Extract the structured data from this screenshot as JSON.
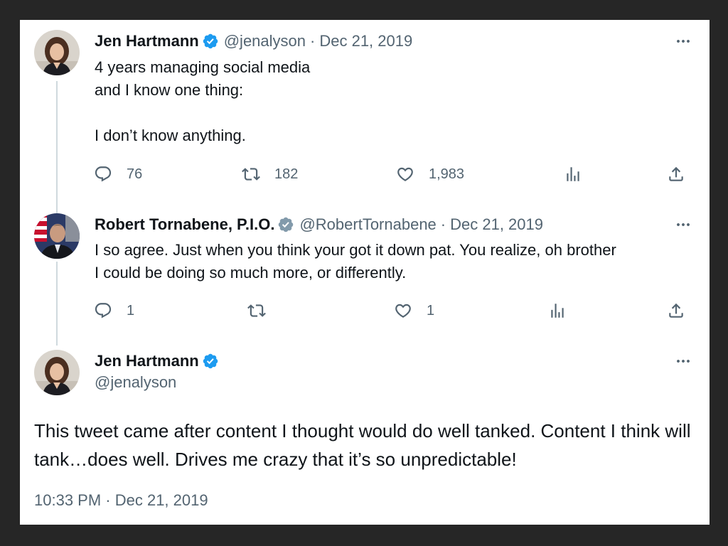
{
  "tweets": [
    {
      "author_name": "Jen Hartmann",
      "verified": true,
      "handle": "@jenalyson",
      "separator": "·",
      "date": "Dec 21, 2019",
      "text": "4 years managing social media\nand I know one thing:\n\nI don’t know anything.",
      "replies": "76",
      "retweets": "182",
      "likes": "1,983",
      "views": ""
    },
    {
      "author_name": "Robert Tornabene, P.I.O.",
      "verified": true,
      "handle": "@RobertTornabene",
      "separator": "·",
      "date": "Dec 21, 2019",
      "text": "I so agree. Just when you think your got it down pat. You realize, oh brother\nI could be doing so much more, or differently.",
      "replies": "1",
      "retweets": "",
      "likes": "1",
      "views": ""
    }
  ],
  "main_tweet": {
    "author_name": "Jen Hartmann",
    "verified": true,
    "handle": "@jenalyson",
    "text": "This tweet came after content I thought would do well tanked. Content I think will tank…does well. Drives me crazy that it’s so unpredictable!",
    "timestamp": "10:33 PM · Dec 21, 2019"
  },
  "icons": {
    "reply": "reply-icon",
    "retweet": "retweet-icon",
    "like": "heart-icon",
    "views": "analytics-icon",
    "share": "share-icon",
    "more": "more-options-icon",
    "verified": "verified-badge-icon"
  },
  "colors": {
    "verified_blue": "#1d9bf0",
    "verified_gray": "#829aab",
    "text_primary": "#0f1419",
    "text_secondary": "#536471",
    "page_background": "#262626",
    "card_background": "#ffffff"
  }
}
